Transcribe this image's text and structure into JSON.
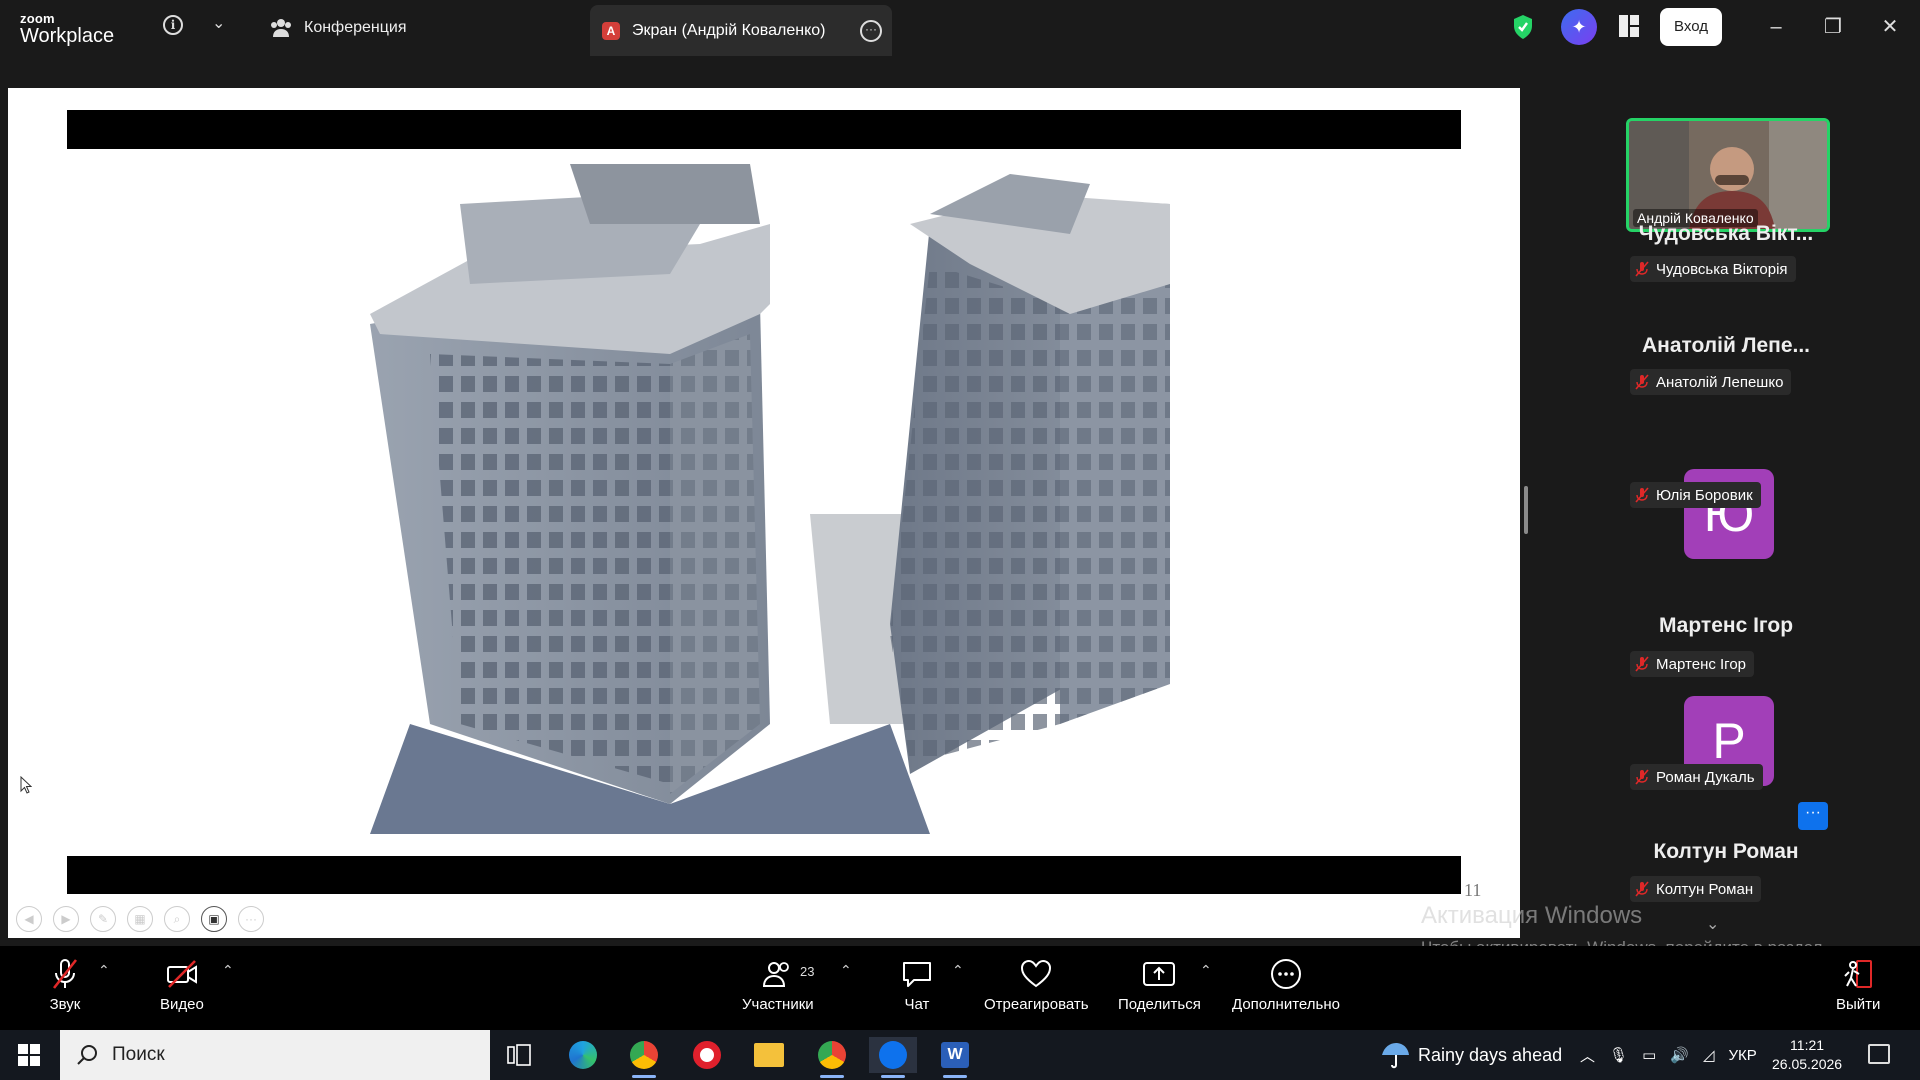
{
  "app": {
    "logo_line1": "zoom",
    "logo_line2": "Workplace",
    "tab_conference": "Конференция",
    "tab_share_badge": "A",
    "tab_share": "Экран (Андрій Коваленко)",
    "login_button": "Вход",
    "accent_green": "#25d366",
    "accent_blue": "#0e72ed"
  },
  "slide": {
    "page_number": "11"
  },
  "panel": {
    "self_name": "Андрій Коваленко",
    "participants": [
      {
        "display": "Чудовська Вікт...",
        "tag": "Чудовська Вікторія",
        "mic": "muted"
      },
      {
        "display": "Анатолій Лепе...",
        "tag": "Анатолій Лепешко",
        "mic": "muted"
      },
      {
        "avatar_letter": "Ю",
        "avatar_color": "#a23fb8",
        "tag": "Юлія Боровик",
        "mic": "muted"
      },
      {
        "display": "Мартенс Ігор",
        "tag": "Мартенс Ігор",
        "mic": "muted"
      },
      {
        "avatar_letter": "Р",
        "avatar_color": "#a23fb8",
        "tag": "Роман Дукаль",
        "mic": "muted"
      },
      {
        "display": "Колтун Роман",
        "tag": "Колтун Роман",
        "mic": "muted"
      }
    ]
  },
  "watermark": {
    "title": "Активация Windows",
    "subtitle": "Чтобы активировать Windows, перейдите в раздел \"Параметры\"."
  },
  "toolbar": {
    "audio": "Звук",
    "video": "Видео",
    "participants": "Участники",
    "participants_count": "23",
    "chat": "Чат",
    "react": "Отреагировать",
    "share": "Поделиться",
    "more": "Дополнительно",
    "leave": "Выйти"
  },
  "taskbar": {
    "search_placeholder": "Поиск",
    "weather": "Rainy days ahead",
    "lang": "УКР",
    "time": "11:21",
    "date": "26.05.2026"
  }
}
